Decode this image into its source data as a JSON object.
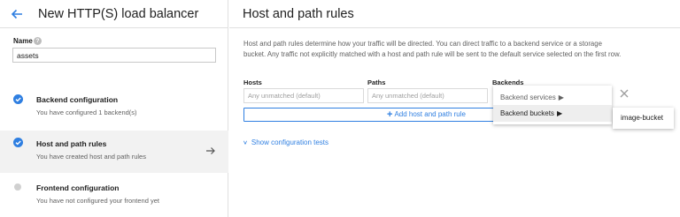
{
  "left": {
    "title": "New HTTP(S) load balancer",
    "name_label": "Name",
    "help_glyph": "?",
    "name_value": "assets",
    "steps": [
      {
        "title": "Backend configuration",
        "subtitle": "You have configured 1 backend(s)",
        "status": "complete"
      },
      {
        "title": "Host and path rules",
        "subtitle": "You have created host and path rules",
        "status": "complete"
      },
      {
        "title": "Frontend configuration",
        "subtitle": "You have not configured your frontend yet",
        "status": "incomplete"
      }
    ]
  },
  "right": {
    "title": "Host and path rules",
    "description": "Host and path rules determine how your traffic will be directed. You can direct traffic to a backend service or a storage bucket. Any traffic not explicitly matched with a host and path rule will be sent to the default service selected on the first row.",
    "columns": {
      "hosts": "Hosts",
      "paths": "Paths",
      "backends": "Backends"
    },
    "hosts_placeholder": "Any unmatched (default)",
    "paths_placeholder": "Any unmatched (default)",
    "add_button": "Add host and path rule",
    "show_tests": "Show configuration tests"
  },
  "backend_menu": {
    "items": [
      {
        "label": "Backend services"
      },
      {
        "label": "Backend buckets"
      }
    ],
    "submenu_item": "image-bucket"
  },
  "colors": {
    "accent": "#2f7fe1",
    "selected_step_bg": "#f2f2f2"
  },
  "icons": [
    "back-arrow-icon",
    "help-icon",
    "check-icon",
    "arrow-right-icon",
    "plus-icon",
    "close-icon",
    "chevron-down-icon",
    "caret-right-icon"
  ]
}
